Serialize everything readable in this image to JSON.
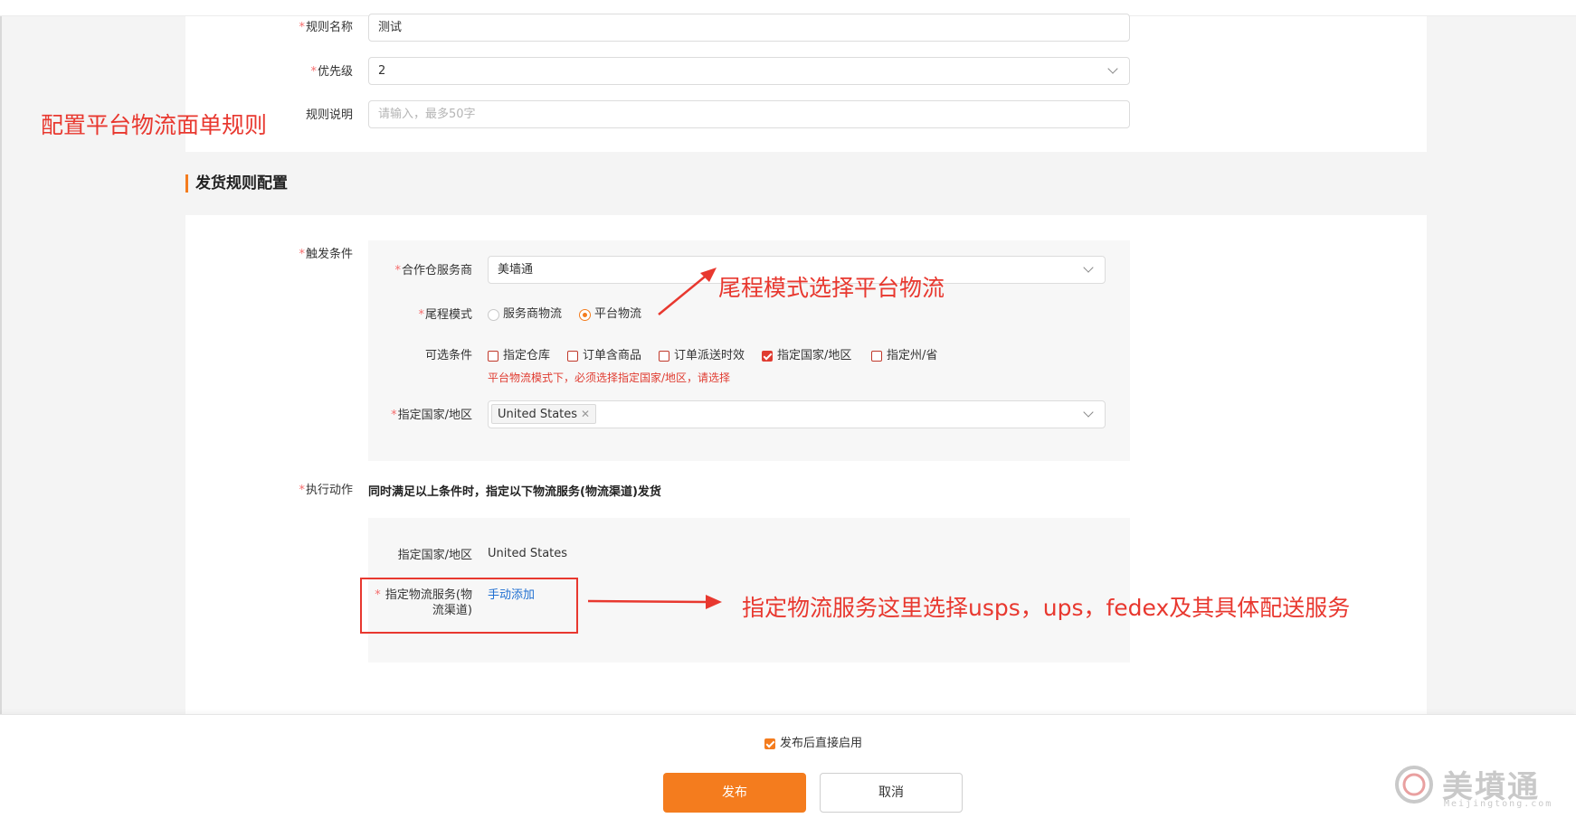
{
  "rule_info": {
    "name_label": "规则名称",
    "name_value": "测试",
    "priority_label": "优先级",
    "priority_value": "2",
    "desc_label": "规则说明",
    "desc_placeholder": "请输入，最多50字"
  },
  "section_title": "发货规则配置",
  "trigger": {
    "label": "触发条件",
    "warehouse_label": "合作仓服务商",
    "warehouse_value": "美墙通",
    "tail_mode_label": "尾程模式",
    "tail_options": [
      {
        "label": "服务商物流",
        "selected": false
      },
      {
        "label": "平台物流",
        "selected": true
      }
    ],
    "optional_label": "可选条件",
    "optional_items": [
      {
        "label": "指定仓库",
        "checked": false
      },
      {
        "label": "订单含商品",
        "checked": false
      },
      {
        "label": "订单派送时效",
        "checked": false
      },
      {
        "label": "指定国家/地区",
        "checked": true
      },
      {
        "label": "指定州/省",
        "checked": false
      }
    ],
    "error_text": "平台物流模式下，必须选择指定国家/地区，请选择",
    "country_label": "指定国家/地区",
    "country_tag": "United States"
  },
  "action": {
    "label": "执行动作",
    "description": "同时满足以上条件时，指定以下物流服务(物流渠道)发货",
    "country_label": "指定国家/地区",
    "country_value": "United States",
    "service_label_line1": "指定物流服务(物",
    "service_label_line2": "流渠道)",
    "manual_add": "手动添加"
  },
  "annotations": {
    "left": "配置平台物流面单规则",
    "tail_mode": "尾程模式选择平台物流",
    "service": "指定物流服务这里选择usps，ups，fedex及其具体配送服务"
  },
  "footer": {
    "enable_label": "发布后直接启用",
    "enable_checked": true,
    "publish": "发布",
    "cancel": "取消"
  },
  "branding": {
    "logo_mark": "M",
    "logo_text": "美墳通",
    "logo_sub": "Meijingtong.com"
  },
  "colors": {
    "accent": "#f47c1e",
    "annotation": "#e8382f",
    "link": "#1f6fd1",
    "error": "#e03c31"
  }
}
